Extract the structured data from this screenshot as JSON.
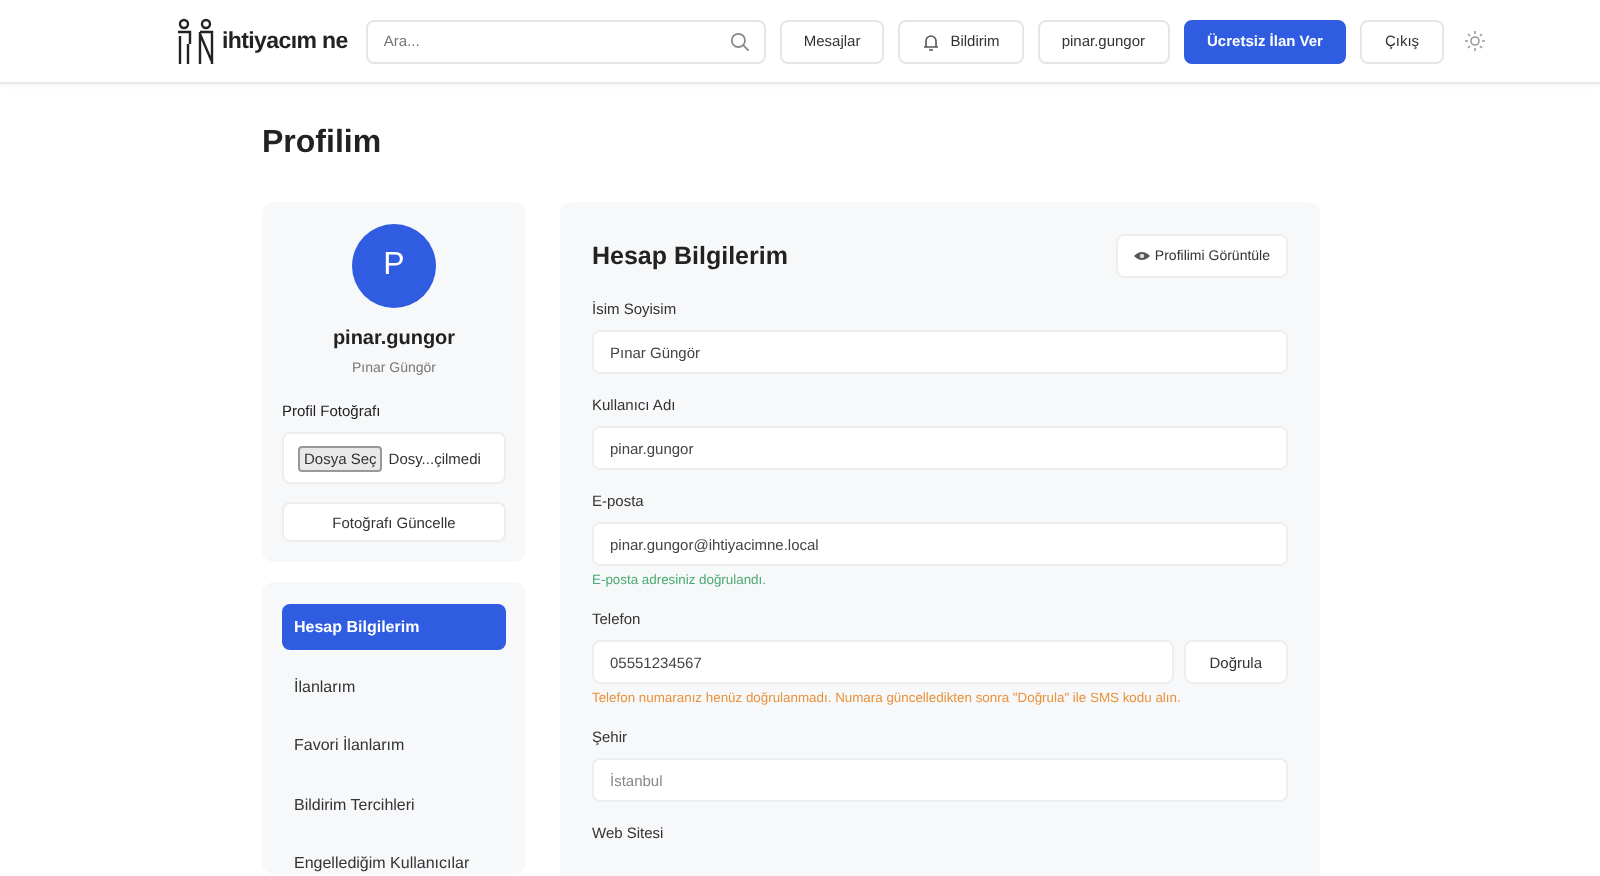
{
  "header": {
    "logo_text": "ihtiyacım ne",
    "search": {
      "placeholder": "Ara..."
    },
    "buttons": [
      {
        "kind": "plain",
        "label": "Mesajlar"
      },
      {
        "kind": "bell",
        "label": "Bildirim"
      },
      {
        "kind": "plain",
        "label": "pinar.gungor"
      },
      {
        "kind": "primary",
        "label": "Ücretsiz İlan Ver"
      },
      {
        "kind": "plain",
        "label": "Çıkış"
      }
    ]
  },
  "page_title": "Profilim",
  "profile_card": {
    "avatar_letter": "P",
    "username": "pinar.gungor",
    "full_name": "Pınar Güngör",
    "photo_label": "Profil Fotoğrafı",
    "file_button": "Dosya Seç",
    "file_status": "Dosy...çilmedi",
    "update_button": "Fotoğrafı Güncelle"
  },
  "nav": [
    {
      "label": "Hesap Bilgilerim",
      "selected": true
    },
    {
      "label": "İlanlarım",
      "selected": false
    },
    {
      "label": "Favori İlanlarım",
      "selected": false
    },
    {
      "label": "Bildirim Tercihleri",
      "selected": false
    },
    {
      "label": "Engellediğim Kullanıcılar",
      "selected": false
    }
  ],
  "form": {
    "title": "Hesap Bilgilerim",
    "view_button": "Profilimi Görüntüle",
    "fields": [
      {
        "label": "İsim Soyisim",
        "value": "Pınar Güngör"
      },
      {
        "label": "Kullanıcı Adı",
        "value": "pinar.gungor"
      },
      {
        "label": "E-posta",
        "value": "pinar.gungor@ihtiyacimne.local",
        "note": {
          "kind": "success",
          "text": "E-posta adresiniz doğrulandı."
        }
      },
      {
        "label": "Telefon",
        "value": "05551234567",
        "action": "Doğrula",
        "note": {
          "kind": "warning",
          "text": "Telefon numaranız henüz doğrulanmadı. Numara güncelledikten sonra \"Doğrula\" ile SMS kodu alın."
        }
      },
      {
        "label": "Şehir",
        "placeholder": "İstanbul"
      },
      {
        "label": "Web Sitesi"
      }
    ]
  }
}
